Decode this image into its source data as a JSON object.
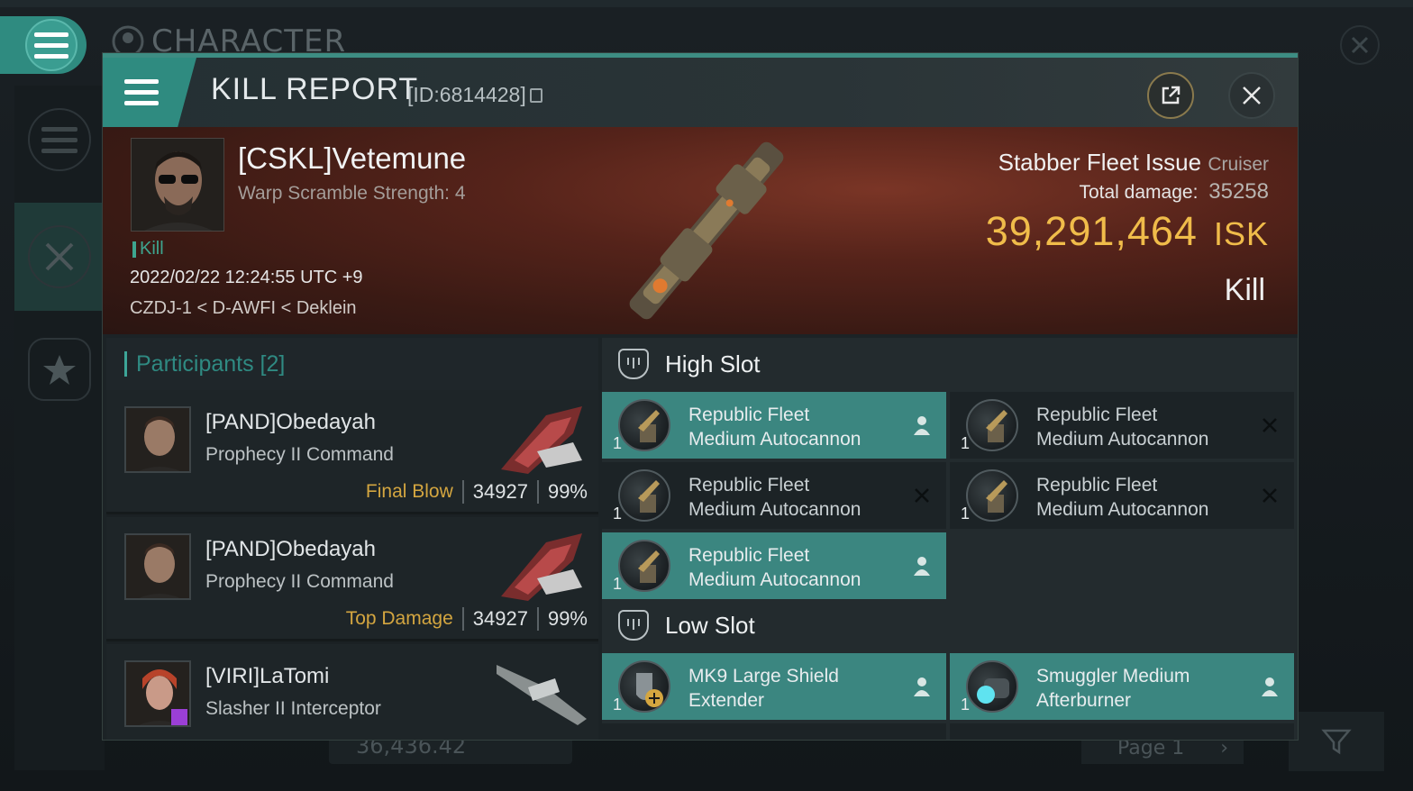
{
  "background": {
    "title": "CHARACTER",
    "bottom_value": "36,436.42",
    "page_label": "Page 1"
  },
  "header": {
    "title": "KILL REPORT",
    "id": "[ID:6814428]"
  },
  "victim": {
    "name": "[CSKL]Vetemune",
    "warp_scramble": "Warp Scramble Strength: 4",
    "tag": "Kill",
    "datetime": "2022/02/22 12:24:55 UTC +9",
    "location": "CZDJ-1 < D-AWFI < Deklein",
    "ship_name": "Stabber Fleet Issue",
    "ship_class": "Cruiser",
    "total_damage_label": "Total damage:",
    "total_damage": "35258",
    "isk_value": "39,291,464",
    "isk_unit": "ISK",
    "result": "Kill"
  },
  "participants": {
    "header": "Participants [2]",
    "items": [
      {
        "name": "[PAND]Obedayah",
        "ship": "Prophecy II Command",
        "role": "Final Blow",
        "damage": "34927",
        "percent": "99%"
      },
      {
        "name": "[PAND]Obedayah",
        "ship": "Prophecy II Command",
        "role": "Top Damage",
        "damage": "34927",
        "percent": "99%"
      },
      {
        "name": "[VIRI]LaTomi",
        "ship": "Slasher II Interceptor",
        "role": "",
        "damage": "",
        "percent": ""
      }
    ]
  },
  "fittings": {
    "high_slot_label": "High Slot",
    "low_slot_label": "Low Slot",
    "high": [
      {
        "line1": "Republic Fleet",
        "line2": "Medium Autocannon",
        "qty": "1",
        "state": "dropped",
        "icon": "autocannon-icon"
      },
      {
        "line1": "Republic Fleet",
        "line2": "Medium Autocannon",
        "qty": "1",
        "state": "destroyed",
        "icon": "autocannon-icon"
      },
      {
        "line1": "Republic Fleet",
        "line2": "Medium Autocannon",
        "qty": "1",
        "state": "destroyed",
        "icon": "autocannon-icon"
      },
      {
        "line1": "Republic Fleet",
        "line2": "Medium Autocannon",
        "qty": "1",
        "state": "destroyed",
        "icon": "autocannon-icon"
      },
      {
        "line1": "Republic Fleet",
        "line2": "Medium Autocannon",
        "qty": "1",
        "state": "dropped",
        "icon": "autocannon-icon"
      }
    ],
    "low": [
      {
        "line1": "MK9 Large Shield",
        "line2": "Extender",
        "qty": "1",
        "state": "dropped",
        "icon": "shield-extender-icon"
      },
      {
        "line1": "Smuggler Medium",
        "line2": "Afterburner",
        "qty": "1",
        "state": "dropped",
        "icon": "afterburner-icon"
      }
    ]
  },
  "colors": {
    "accent": "#3b8680",
    "isk": "#f0bc4a",
    "role": "#d4a640"
  }
}
